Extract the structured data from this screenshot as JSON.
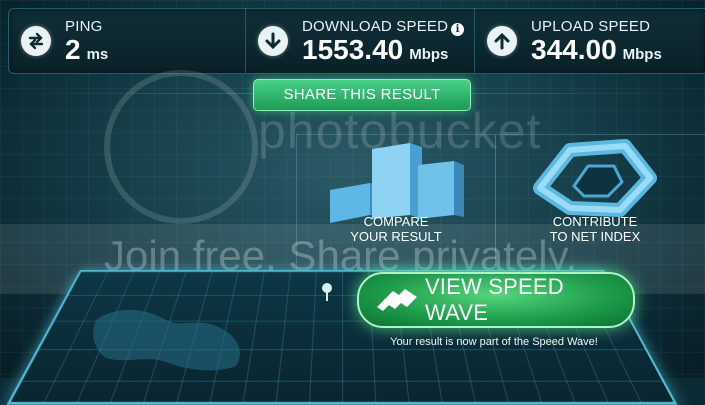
{
  "stats": {
    "ping": {
      "label": "PING",
      "value": "2",
      "unit": "ms",
      "icon": "exchange-arrows-icon"
    },
    "download": {
      "label": "DOWNLOAD SPEED",
      "value": "1553.40",
      "unit": "Mbps",
      "icon": "arrow-down-icon",
      "info": "i"
    },
    "upload": {
      "label": "UPLOAD SPEED",
      "value": "344.00",
      "unit": "Mbps",
      "icon": "arrow-up-icon"
    }
  },
  "share": {
    "label": "SHARE THIS RESULT"
  },
  "compare": {
    "line1": "COMPARE",
    "line2": "YOUR RESULT",
    "icon": "bar-chart-icon"
  },
  "contribute": {
    "line1": "CONTRIBUTE",
    "line2": "TO NET INDEX",
    "icon": "net-index-icon"
  },
  "wave": {
    "label": "VIEW SPEED WAVE",
    "caption": "Your result is now part of the Speed Wave!",
    "icon": "speed-wave-icon"
  },
  "watermark": {
    "brand": "photobucket",
    "tagline": "Join free. Share privately."
  },
  "colors": {
    "accent_green": "#2fb866",
    "panel_border": "#1f6070",
    "background": "#16404b"
  }
}
